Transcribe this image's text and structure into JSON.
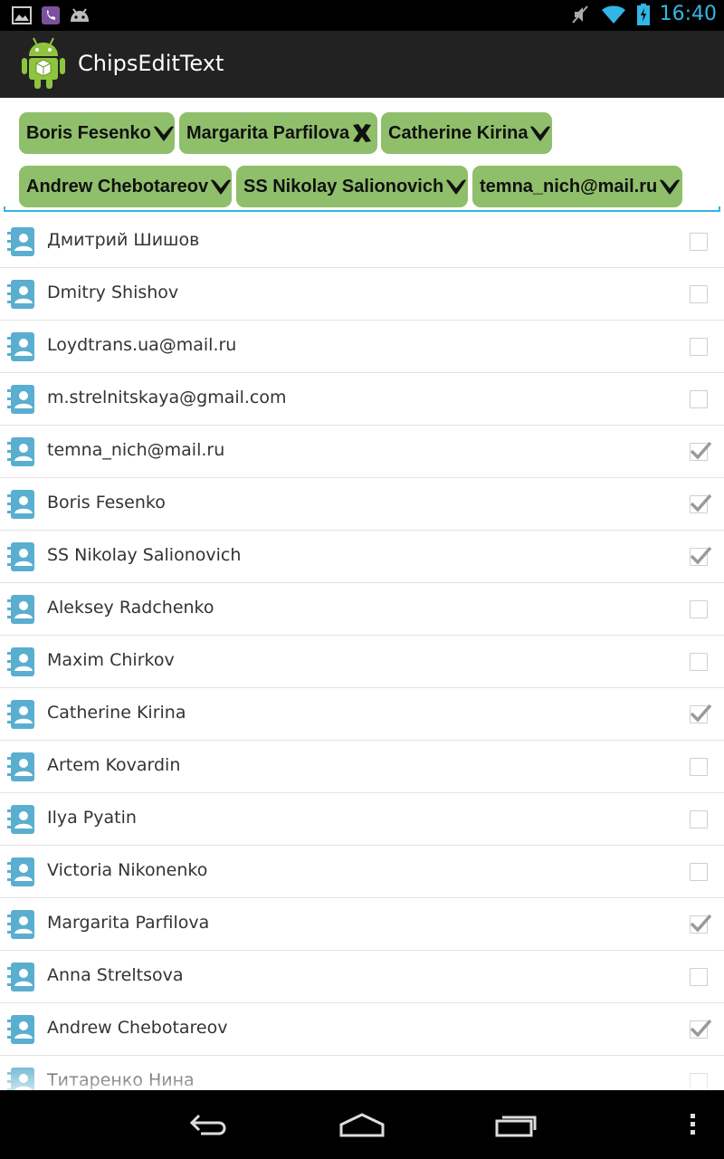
{
  "status_bar": {
    "time": "16:40",
    "left_icons": [
      "gallery-icon",
      "viber-icon",
      "android-debug-icon"
    ],
    "right_icons": [
      "mute-icon",
      "wifi-icon",
      "battery-charging-icon"
    ],
    "accent_color": "#33b5e5"
  },
  "action_bar": {
    "title": "ChipsEditText"
  },
  "chips": {
    "color": "#8fbf6a",
    "items": [
      {
        "label": "Boris Fesenko",
        "icon": "chevron-down-icon"
      },
      {
        "label": "Margarita Parfilova",
        "icon": "close-icon"
      },
      {
        "label": "Catherine Kirina",
        "icon": "chevron-down-icon"
      },
      {
        "label": "Andrew Chebotareov",
        "icon": "chevron-down-icon"
      },
      {
        "label": "SS Nikolay Salionovich",
        "icon": "chevron-down-icon"
      },
      {
        "label": "temna_nich@mail.ru",
        "icon": "chevron-down-icon"
      }
    ]
  },
  "contacts": [
    {
      "name": "Дмитрий Шишов",
      "checked": false
    },
    {
      "name": "Dmitry Shishov",
      "checked": false
    },
    {
      "name": "Loydtrans.ua@mail.ru",
      "checked": false
    },
    {
      "name": "m.strelnitskaya@gmail.com",
      "checked": false
    },
    {
      "name": "temna_nich@mail.ru",
      "checked": true
    },
    {
      "name": "Boris Fesenko",
      "checked": true
    },
    {
      "name": "SS Nikolay Salionovich",
      "checked": true
    },
    {
      "name": "Aleksey Radchenko",
      "checked": false
    },
    {
      "name": "Maxim Chirkov",
      "checked": false
    },
    {
      "name": "Catherine Kirina",
      "checked": true
    },
    {
      "name": "Artem Kovardin",
      "checked": false
    },
    {
      "name": "Ilya Pyatin",
      "checked": false
    },
    {
      "name": "Victoria Nikonenko",
      "checked": false
    },
    {
      "name": "Margarita Parfilova",
      "checked": true
    },
    {
      "name": "Anna Streltsova",
      "checked": false
    },
    {
      "name": "Andrew Chebotareov",
      "checked": true
    },
    {
      "name": "Титаренко Нина",
      "checked": false
    }
  ],
  "nav_bar": {
    "buttons": [
      "back-icon",
      "home-icon",
      "recents-icon",
      "menu-overflow-icon"
    ]
  }
}
